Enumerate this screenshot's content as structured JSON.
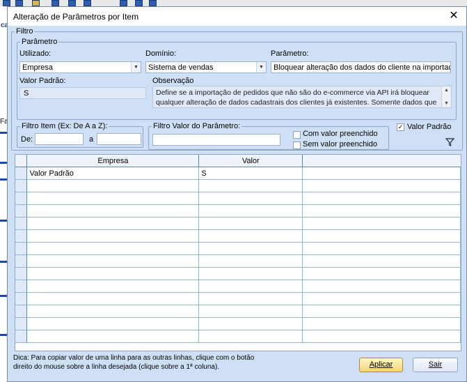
{
  "background": {
    "left_label_top": "ca",
    "left_label_mid": "Fa"
  },
  "dialog": {
    "title": "Alteração de Parâmetros por Item"
  },
  "filtro": {
    "legend": "Filtro",
    "parametro": {
      "legend": "Parâmetro",
      "utilizado": {
        "label": "Utilizado:",
        "value": "Empresa"
      },
      "dominio": {
        "label": "Domínio:",
        "value": "Sistema de vendas"
      },
      "parametro": {
        "label": "Parâmetro:",
        "value": "Bloquear alteração dos dados do cliente na importação d"
      },
      "valor_padrao": {
        "label": "Valor Padrão:",
        "value": "S"
      },
      "observacao": {
        "label": "Observação",
        "text": "Define se a importação de pedidos que não são do e-commerce via API irá bloquear qualquer alteração de dados cadastrais dos clientes já existentes. Somente dados que"
      }
    },
    "filtro_item": {
      "legend": "Filtro Item (Ex: De A a Z):",
      "de_label": "De:",
      "a_label": "a",
      "de_value": "",
      "a_value": ""
    },
    "filtro_valor": {
      "legend": "Filtro Valor do Parâmetro:",
      "value": "",
      "com_valor": {
        "label": "Com valor preenchido",
        "checked": false
      },
      "sem_valor": {
        "label": "Sem valor preenchido",
        "checked": false
      }
    },
    "valor_padrao_check": {
      "label": "Valor Padrão",
      "checked": true
    }
  },
  "grid": {
    "columns": [
      "Empresa",
      "Valor"
    ],
    "rows": [
      {
        "empresa": "Valor Padrão",
        "valor": "S"
      }
    ]
  },
  "footer": {
    "hint_line1": "Dica: Para copiar valor de uma linha para as outras linhas, clique com o botão",
    "hint_line2": "direito do mouse sobre a linha desejada (clique sobre a 1ª coluna).",
    "aplicar_label": "Aplicar",
    "sair_label": "Sair"
  },
  "icons": {
    "close": "close-icon",
    "filter": "filter-icon",
    "dropdown": "chevron-down-icon"
  },
  "colors": {
    "dialog_bg": "#cfe0f6",
    "grid_line": "#8db4e4",
    "primary_button": "#f3d37a"
  }
}
